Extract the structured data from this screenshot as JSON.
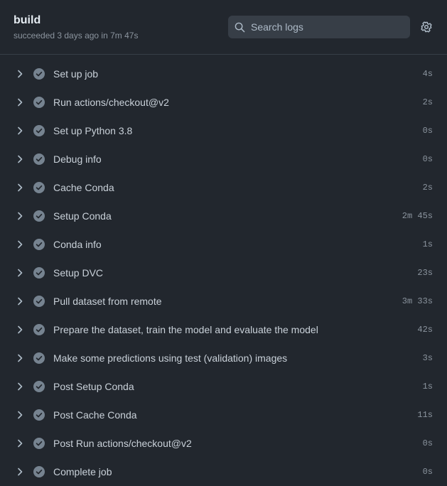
{
  "header": {
    "title": "build",
    "status": "succeeded 3 days ago in 7m 47s"
  },
  "search": {
    "placeholder": "Search logs",
    "icon": "search-icon"
  },
  "settings": {
    "icon": "gear-icon"
  },
  "colors": {
    "background": "#22272e",
    "search_bg": "#373e47",
    "success_check": "#768390"
  },
  "steps": [
    {
      "name": "Set up job",
      "duration": "4s"
    },
    {
      "name": "Run actions/checkout@v2",
      "duration": "2s"
    },
    {
      "name": "Set up Python 3.8",
      "duration": "0s"
    },
    {
      "name": "Debug info",
      "duration": "0s"
    },
    {
      "name": "Cache Conda",
      "duration": "2s"
    },
    {
      "name": "Setup Conda",
      "duration": "2m 45s"
    },
    {
      "name": "Conda info",
      "duration": "1s"
    },
    {
      "name": "Setup DVC",
      "duration": "23s"
    },
    {
      "name": "Pull dataset from remote",
      "duration": "3m 33s"
    },
    {
      "name": "Prepare the dataset, train the model and evaluate the model",
      "duration": "42s"
    },
    {
      "name": "Make some predictions using test (validation) images",
      "duration": "3s"
    },
    {
      "name": "Post Setup Conda",
      "duration": "1s"
    },
    {
      "name": "Post Cache Conda",
      "duration": "11s"
    },
    {
      "name": "Post Run actions/checkout@v2",
      "duration": "0s"
    },
    {
      "name": "Complete job",
      "duration": "0s"
    }
  ]
}
